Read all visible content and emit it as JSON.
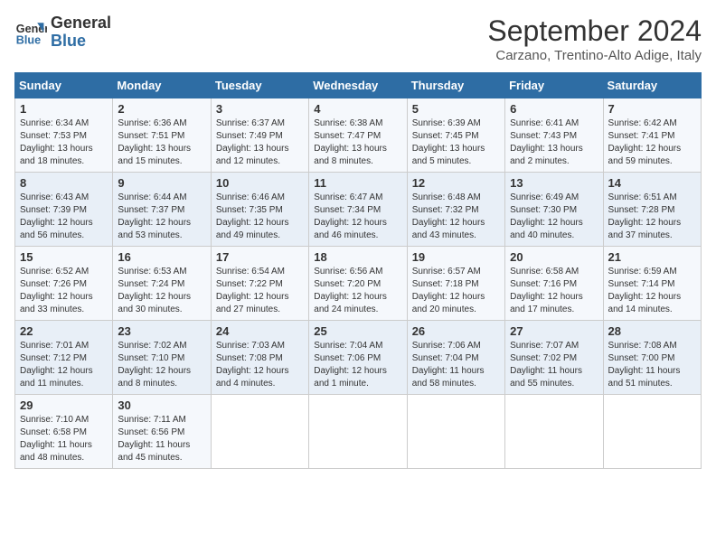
{
  "logo": {
    "line1": "General",
    "line2": "Blue"
  },
  "title": "September 2024",
  "subtitle": "Carzano, Trentino-Alto Adige, Italy",
  "days_of_week": [
    "Sunday",
    "Monday",
    "Tuesday",
    "Wednesday",
    "Thursday",
    "Friday",
    "Saturday"
  ],
  "weeks": [
    [
      {
        "day": "1",
        "sunrise": "6:34 AM",
        "sunset": "7:53 PM",
        "daylight": "13 hours and 18 minutes."
      },
      {
        "day": "2",
        "sunrise": "6:36 AM",
        "sunset": "7:51 PM",
        "daylight": "13 hours and 15 minutes."
      },
      {
        "day": "3",
        "sunrise": "6:37 AM",
        "sunset": "7:49 PM",
        "daylight": "13 hours and 12 minutes."
      },
      {
        "day": "4",
        "sunrise": "6:38 AM",
        "sunset": "7:47 PM",
        "daylight": "13 hours and 8 minutes."
      },
      {
        "day": "5",
        "sunrise": "6:39 AM",
        "sunset": "7:45 PM",
        "daylight": "13 hours and 5 minutes."
      },
      {
        "day": "6",
        "sunrise": "6:41 AM",
        "sunset": "7:43 PM",
        "daylight": "13 hours and 2 minutes."
      },
      {
        "day": "7",
        "sunrise": "6:42 AM",
        "sunset": "7:41 PM",
        "daylight": "12 hours and 59 minutes."
      }
    ],
    [
      {
        "day": "8",
        "sunrise": "6:43 AM",
        "sunset": "7:39 PM",
        "daylight": "12 hours and 56 minutes."
      },
      {
        "day": "9",
        "sunrise": "6:44 AM",
        "sunset": "7:37 PM",
        "daylight": "12 hours and 53 minutes."
      },
      {
        "day": "10",
        "sunrise": "6:46 AM",
        "sunset": "7:35 PM",
        "daylight": "12 hours and 49 minutes."
      },
      {
        "day": "11",
        "sunrise": "6:47 AM",
        "sunset": "7:34 PM",
        "daylight": "12 hours and 46 minutes."
      },
      {
        "day": "12",
        "sunrise": "6:48 AM",
        "sunset": "7:32 PM",
        "daylight": "12 hours and 43 minutes."
      },
      {
        "day": "13",
        "sunrise": "6:49 AM",
        "sunset": "7:30 PM",
        "daylight": "12 hours and 40 minutes."
      },
      {
        "day": "14",
        "sunrise": "6:51 AM",
        "sunset": "7:28 PM",
        "daylight": "12 hours and 37 minutes."
      }
    ],
    [
      {
        "day": "15",
        "sunrise": "6:52 AM",
        "sunset": "7:26 PM",
        "daylight": "12 hours and 33 minutes."
      },
      {
        "day": "16",
        "sunrise": "6:53 AM",
        "sunset": "7:24 PM",
        "daylight": "12 hours and 30 minutes."
      },
      {
        "day": "17",
        "sunrise": "6:54 AM",
        "sunset": "7:22 PM",
        "daylight": "12 hours and 27 minutes."
      },
      {
        "day": "18",
        "sunrise": "6:56 AM",
        "sunset": "7:20 PM",
        "daylight": "12 hours and 24 minutes."
      },
      {
        "day": "19",
        "sunrise": "6:57 AM",
        "sunset": "7:18 PM",
        "daylight": "12 hours and 20 minutes."
      },
      {
        "day": "20",
        "sunrise": "6:58 AM",
        "sunset": "7:16 PM",
        "daylight": "12 hours and 17 minutes."
      },
      {
        "day": "21",
        "sunrise": "6:59 AM",
        "sunset": "7:14 PM",
        "daylight": "12 hours and 14 minutes."
      }
    ],
    [
      {
        "day": "22",
        "sunrise": "7:01 AM",
        "sunset": "7:12 PM",
        "daylight": "12 hours and 11 minutes."
      },
      {
        "day": "23",
        "sunrise": "7:02 AM",
        "sunset": "7:10 PM",
        "daylight": "12 hours and 8 minutes."
      },
      {
        "day": "24",
        "sunrise": "7:03 AM",
        "sunset": "7:08 PM",
        "daylight": "12 hours and 4 minutes."
      },
      {
        "day": "25",
        "sunrise": "7:04 AM",
        "sunset": "7:06 PM",
        "daylight": "12 hours and 1 minute."
      },
      {
        "day": "26",
        "sunrise": "7:06 AM",
        "sunset": "7:04 PM",
        "daylight": "11 hours and 58 minutes."
      },
      {
        "day": "27",
        "sunrise": "7:07 AM",
        "sunset": "7:02 PM",
        "daylight": "11 hours and 55 minutes."
      },
      {
        "day": "28",
        "sunrise": "7:08 AM",
        "sunset": "7:00 PM",
        "daylight": "11 hours and 51 minutes."
      }
    ],
    [
      {
        "day": "29",
        "sunrise": "7:10 AM",
        "sunset": "6:58 PM",
        "daylight": "11 hours and 48 minutes."
      },
      {
        "day": "30",
        "sunrise": "7:11 AM",
        "sunset": "6:56 PM",
        "daylight": "11 hours and 45 minutes."
      },
      null,
      null,
      null,
      null,
      null
    ]
  ]
}
